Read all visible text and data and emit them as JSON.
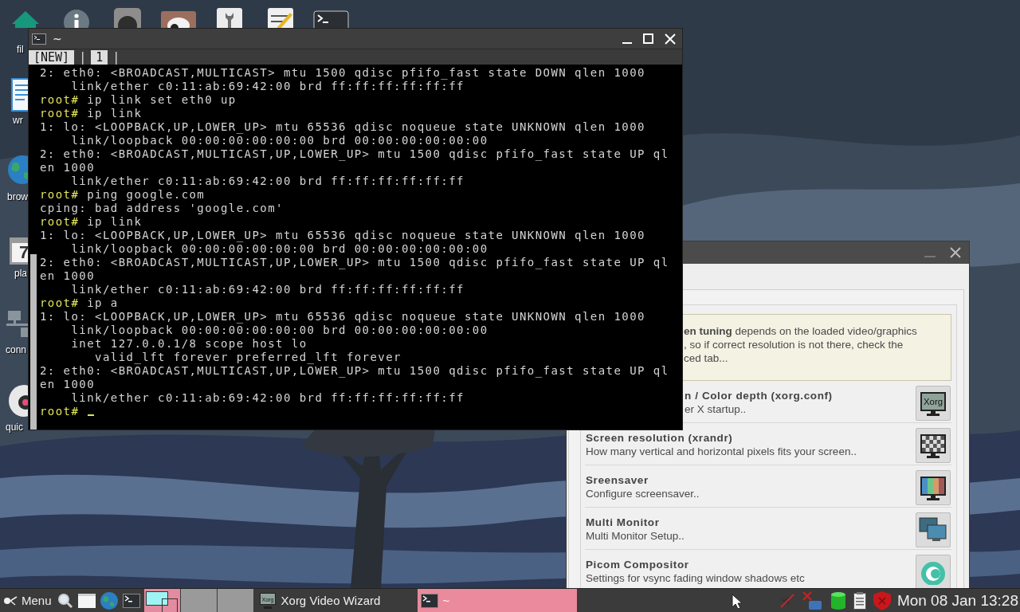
{
  "desktop_icons": [
    {
      "kind": "home",
      "label": "fil"
    },
    {
      "kind": "info"
    },
    {
      "kind": "blank"
    },
    {
      "kind": "mascot"
    },
    {
      "kind": "wrench"
    },
    {
      "kind": "notepad"
    },
    {
      "kind": "terminal"
    },
    {
      "kind": "document",
      "label": "wr"
    },
    {
      "kind": "globe",
      "label": "brow"
    },
    {
      "kind": "calendar",
      "label": "pla",
      "day": "7"
    },
    {
      "kind": "network",
      "label": "conn"
    },
    {
      "kind": "mascot-round",
      "label": "quic"
    }
  ],
  "terminal": {
    "title": "~",
    "tabs": [
      {
        "label": "[NEW]",
        "separator": "|"
      },
      {
        "label": "1",
        "separator": "|"
      }
    ],
    "lines": [
      {
        "kind": "output",
        "text": "2: eth0: <BROADCAST,MULTICAST> mtu 1500 qdisc pfifo_fast state DOWN qlen 1000"
      },
      {
        "kind": "output",
        "text": "    link/ether c0:11:ab:69:42:00 brd ff:ff:ff:ff:ff:ff"
      },
      {
        "kind": "prompt",
        "prompt": "root#",
        "text": "ip link set eth0 up"
      },
      {
        "kind": "prompt",
        "prompt": "root#",
        "text": "ip link"
      },
      {
        "kind": "output",
        "text": "1: lo: <LOOPBACK,UP,LOWER_UP> mtu 65536 qdisc noqueue state UNKNOWN qlen 1000"
      },
      {
        "kind": "output",
        "text": "    link/loopback 00:00:00:00:00:00 brd 00:00:00:00:00:00"
      },
      {
        "kind": "output",
        "text": "2: eth0: <BROADCAST,MULTICAST,UP,LOWER_UP> mtu 1500 qdisc pfifo_fast state UP ql"
      },
      {
        "kind": "output",
        "text": "en 1000"
      },
      {
        "kind": "output",
        "text": "    link/ether c0:11:ab:69:42:00 brd ff:ff:ff:ff:ff:ff"
      },
      {
        "kind": "prompt",
        "prompt": "root#",
        "text": "ping google.com"
      },
      {
        "kind": "output",
        "text": "cping: bad address 'google.com'"
      },
      {
        "kind": "prompt",
        "prompt": "root#",
        "text": "ip link"
      },
      {
        "kind": "output",
        "text": "1: lo: <LOOPBACK,UP,LOWER_UP> mtu 65536 qdisc noqueue state UNKNOWN qlen 1000"
      },
      {
        "kind": "output",
        "text": "    link/loopback 00:00:00:00:00:00 brd 00:00:00:00:00:00"
      },
      {
        "kind": "output",
        "text": "2: eth0: <BROADCAST,MULTICAST,UP,LOWER_UP> mtu 1500 qdisc pfifo_fast state UP ql"
      },
      {
        "kind": "output",
        "text": "en 1000"
      },
      {
        "kind": "output",
        "text": "    link/ether c0:11:ab:69:42:00 brd ff:ff:ff:ff:ff:ff"
      },
      {
        "kind": "prompt",
        "prompt": "root#",
        "text": "ip a"
      },
      {
        "kind": "output",
        "text": "1: lo: <LOOPBACK,UP,LOWER_UP> mtu 65536 qdisc noqueue state UNKNOWN qlen 1000"
      },
      {
        "kind": "output",
        "text": "    link/loopback 00:00:00:00:00:00 brd 00:00:00:00:00:00"
      },
      {
        "kind": "output",
        "text": "    inet 127.0.0.1/8 scope host lo"
      },
      {
        "kind": "output",
        "text": "       valid_lft forever preferred_lft forever"
      },
      {
        "kind": "output",
        "text": "2: eth0: <BROADCAST,MULTICAST,UP,LOWER_UP> mtu 1500 qdisc pfifo_fast state UP ql"
      },
      {
        "kind": "output",
        "text": "en 1000"
      },
      {
        "kind": "output",
        "text": "    link/ether c0:11:ab:69:42:00 brd ff:ff:ff:ff:ff:ff"
      },
      {
        "kind": "prompt",
        "prompt": "root#",
        "cursor": true
      }
    ]
  },
  "wizard": {
    "notice": [
      "**en tuning** depends on the loaded video/graphics",
      ", so if correct resolution is not there, check the",
      "ced tab..."
    ],
    "items": [
      {
        "kind": "xorg",
        "icon_text": "Xorg",
        "title": "n / Color depth (xorg.conf)",
        "subtitle": "er X startup.."
      },
      {
        "kind": "checker",
        "title": "Screen resolution (xrandr)",
        "subtitle": "How many vertical and horizontal pixels fits your screen.."
      },
      {
        "kind": "rainbow",
        "title": "Sreensaver",
        "subtitle": "Configure screensaver.."
      },
      {
        "kind": "multi",
        "title": "Multi Monitor",
        "subtitle": "Multi Monitor Setup.."
      },
      {
        "kind": "gear",
        "title": "Picom Compositor",
        "subtitle": "Settings for vsync fading window shadows etc"
      }
    ]
  },
  "taskbar": {
    "menu_label": "Menu",
    "launchers": [
      {
        "kind": "search"
      },
      {
        "kind": "window"
      },
      {
        "kind": "globe"
      },
      {
        "kind": "terminal"
      }
    ],
    "workspaces": [
      {
        "selected": true
      },
      {
        "selected": false
      },
      {
        "selected": false
      }
    ],
    "tasks": [
      {
        "kind": "xorg",
        "icon_text": "Xorg",
        "label": "Xorg Video Wizard",
        "selected": false
      },
      {
        "kind": "terminal",
        "label": "~",
        "selected": true
      }
    ],
    "tray": [
      {
        "kind": "muted"
      },
      {
        "kind": "network-off"
      },
      {
        "kind": "disk"
      },
      {
        "kind": "clipboard"
      },
      {
        "kind": "shield"
      }
    ],
    "clock": "Mon 08 Jan 13:28"
  }
}
